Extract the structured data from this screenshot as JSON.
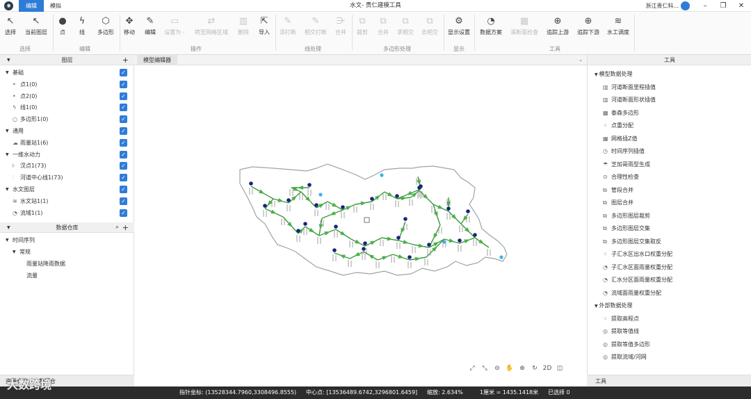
{
  "titlebar": {
    "tab_edit": "编辑",
    "tab_sim": "模拟",
    "title": "水文- 贵仁建模工具",
    "user": "浙江贵仁科..."
  },
  "ribbon": {
    "buttons": [
      {
        "label": "选择",
        "icon": "cursor-icon"
      },
      {
        "label": "当前图层",
        "icon": "cursor-layer-icon"
      },
      {
        "label": "点",
        "icon": "point-icon"
      },
      {
        "label": "线",
        "icon": "line-icon"
      },
      {
        "label": "多边形",
        "icon": "polygon-icon"
      },
      {
        "label": "移动",
        "icon": "move-icon"
      },
      {
        "label": "编辑",
        "icon": "pen-icon"
      },
      {
        "label": "设置为 -",
        "icon": "set-icon"
      },
      {
        "label": "转至网格区域",
        "icon": "grid-goto-icon"
      },
      {
        "label": "删除",
        "icon": "delete-icon"
      },
      {
        "label": "导入",
        "icon": "import-icon"
      },
      {
        "label": "添打断",
        "icon": "break-add-icon"
      },
      {
        "label": "相交打断",
        "icon": "intersect-break-icon"
      },
      {
        "label": "合并",
        "icon": "merge-icon"
      },
      {
        "label": "裁剪",
        "icon": "clip-icon"
      },
      {
        "label": "合并",
        "icon": "union-icon"
      },
      {
        "label": "求相交",
        "icon": "intersect-icon"
      },
      {
        "label": "去相交",
        "icon": "remove-intersect-icon"
      },
      {
        "label": "显示设置",
        "icon": "gear-icon"
      },
      {
        "label": "数据方案",
        "icon": "data-scheme-icon"
      },
      {
        "label": "溪断面检查",
        "icon": "section-check-icon"
      },
      {
        "label": "追踪上游",
        "icon": "trace-up-icon"
      },
      {
        "label": "追踪下游",
        "icon": "trace-down-icon"
      },
      {
        "label": "水工调度",
        "icon": "dispatch-icon"
      }
    ],
    "groups": [
      "选择",
      "编辑",
      "操作",
      "线处理",
      "多边形处理",
      "显示",
      "工具"
    ]
  },
  "left": {
    "layers_title": "图层",
    "layers": [
      {
        "label": "基础",
        "kind": "group"
      },
      {
        "label": "点1(0)",
        "kind": "item",
        "icon": "dot-icon"
      },
      {
        "label": "点2(0)",
        "kind": "item",
        "icon": "dot-icon"
      },
      {
        "label": "线1(0)",
        "kind": "item",
        "icon": "line-small-icon"
      },
      {
        "label": "多边形1(0)",
        "kind": "item",
        "icon": "circle-icon"
      },
      {
        "label": "通用",
        "kind": "group"
      },
      {
        "label": "雨量站1(6)",
        "kind": "item",
        "icon": "rain-station-icon"
      },
      {
        "label": "一维水动力",
        "kind": "group"
      },
      {
        "label": "汊点1(73)",
        "kind": "item",
        "icon": "junction-icon"
      },
      {
        "label": "河道中心线1(73)",
        "kind": "item",
        "icon": "centerline-icon"
      },
      {
        "label": "水文图层",
        "kind": "group"
      },
      {
        "label": "水文站1(1)",
        "kind": "item",
        "icon": "hydro-station-icon"
      },
      {
        "label": "流域1(1)",
        "kind": "item",
        "icon": "basin-icon"
      }
    ],
    "warehouse_title": "数据仓库",
    "warehouse": [
      {
        "label": "时间序列",
        "level": 0
      },
      {
        "label": "常规",
        "level": 1
      },
      {
        "label": "雨量站降雨数据",
        "level": 2
      },
      {
        "label": "流量",
        "level": 2
      }
    ],
    "bottom_tabs": [
      "资源仓库",
      "数据仓"
    ]
  },
  "center": {
    "tab": "模型编辑器",
    "zoom_tools": [
      "⤢",
      "⤡",
      "⊖",
      "✋",
      "⊕",
      "↻",
      "2D",
      "◫"
    ]
  },
  "right": {
    "title": "工具",
    "sections": [
      {
        "title": "模型数据处理",
        "items": [
          "河道断面里程插值",
          "河道断面形状插值",
          "泰森多边形",
          "点重分配",
          "网格插Z值",
          "时间序列插值",
          "芝加哥雨型生成",
          "合理性检查",
          "管段合并",
          "图层合并",
          "多边形图层裁剪",
          "多边形图层交集",
          "多边形图层交集取反",
          "子汇水区出水口权重分配",
          "子汇水区面雨量权重分配",
          "汇水分区面雨量权重分配",
          "流域面雨量权重分配"
        ]
      },
      {
        "title": "外部数据处理",
        "items": [
          "提取高程点",
          "提取等值线",
          "提取等值多边形",
          "提取流域/河网"
        ]
      }
    ],
    "bottom_tab": "工具"
  },
  "status": {
    "pointer": "指针坐标: (13528344.7960,3308496.8555)",
    "center": "中心点: [13536489.6742,3296801.6459]",
    "scale": "缩放: 2.634%",
    "ratio": "1厘米 = 1435.1418米",
    "selected": "已选择 0"
  },
  "watermark": "大数跨境"
}
